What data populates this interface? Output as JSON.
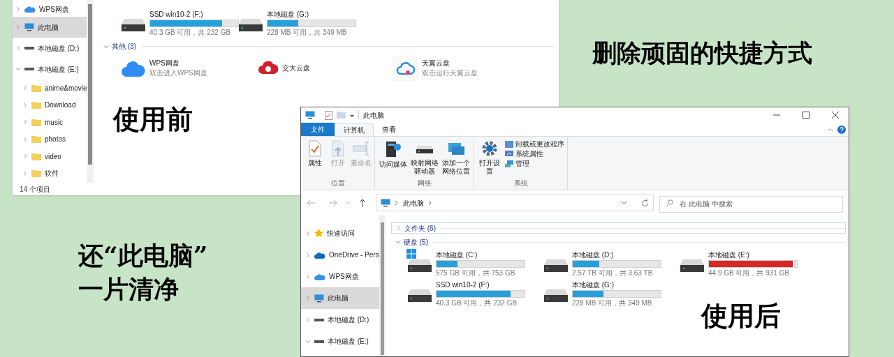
{
  "headline": "删除顽固的快捷方式",
  "summary": [
    "还“此电脑”",
    "一片清净"
  ],
  "before_label": "使用前",
  "after_label": "使用后",
  "before_window": {
    "sidebar": [
      {
        "label": "WPS网盘",
        "selected": false,
        "expanded": false
      },
      {
        "label": "此电脑",
        "selected": true,
        "expanded": false
      },
      {
        "label": "本地磁盘 (D:)",
        "selected": false,
        "expanded": false
      },
      {
        "label": "本地磁盘 (E:)",
        "selected": false,
        "expanded": true,
        "children": [
          {
            "label": "anime&movie",
            "selected": false,
            "expanded": false
          },
          {
            "label": "Download",
            "selected": false,
            "expanded": false
          },
          {
            "label": "music",
            "selected": false,
            "expanded": false
          },
          {
            "label": "photos",
            "selected": false,
            "expanded": false
          },
          {
            "label": "video",
            "selected": false,
            "expanded": false
          },
          {
            "label": "软件",
            "selected": false,
            "expanded": false
          }
        ]
      }
    ],
    "drives": [
      {
        "name": "SSD win10-2 (F:)",
        "kind": "disk",
        "level": 0.82,
        "space": "40.3 GB 可用，共 232 GB"
      },
      {
        "name": "本地磁盘 (G:)",
        "kind": "disk",
        "level": 0.35,
        "space": "228 MB 可用，共 349 MB"
      }
    ],
    "groups": [
      {
        "label": "其他 (3)",
        "expanded": true,
        "items": [
          {
            "name": "WPS网盘",
            "subtitle": "双击进入WPS网盘",
            "kind": "wps"
          },
          {
            "name": "交大云盘",
            "kind": "jd"
          },
          {
            "name": "天翼云盘",
            "subtitle": "双击运行天翼云盘",
            "kind": "ty"
          }
        ]
      }
    ],
    "status_bar": "14 个项目"
  },
  "after_window": {
    "title": "此电脑",
    "tabs": [
      {
        "label": "文件",
        "selected": false
      },
      {
        "label": "计算机",
        "selected": true
      },
      {
        "label": "查看",
        "selected": false
      }
    ],
    "ribbon": [
      {
        "label": "位置",
        "items": [
          {
            "label": "属性",
            "disabled": false
          },
          {
            "label": "打开",
            "disabled": true
          },
          {
            "label": "重命名",
            "disabled": true
          }
        ]
      },
      {
        "label": "网络",
        "items": [
          {
            "label": "访问媒体",
            "disabled": false
          },
          {
            "label": "映射网络驱动器",
            "disabled": false
          },
          {
            "label": "添加一个网络位置",
            "disabled": false
          }
        ]
      },
      {
        "label": "系统",
        "items": [
          {
            "label": "打开设置",
            "disabled": false
          }
        ],
        "small_items": [
          {
            "label": "卸载或更改程序"
          },
          {
            "label": "系统属性"
          },
          {
            "label": "管理"
          }
        ]
      }
    ],
    "breadcrumb": [
      "此电脑"
    ],
    "search": {
      "placeholder": "在 此电脑 中搜索"
    },
    "sidebar": [
      {
        "label": "快速访问",
        "selected": false,
        "expanded": false
      },
      {
        "label": "OneDrive - Pers",
        "selected": false,
        "expanded": false
      },
      {
        "label": "WPS网盘",
        "selected": false,
        "expanded": false
      },
      {
        "label": "此电脑",
        "selected": true,
        "expanded": false
      },
      {
        "label": "本地磁盘 (D:)",
        "selected": false,
        "expanded": false
      },
      {
        "label": "本地磁盘 (E:)",
        "selected": false,
        "expanded": true
      }
    ],
    "groups": [
      {
        "label": "文件夹 (6)",
        "expanded": false
      },
      {
        "label": "硬盘 (5)",
        "expanded": true
      }
    ],
    "drives": [
      {
        "name": "本地磁盘 (C:)",
        "kind": "system",
        "level": 0.24,
        "space": "575 GB 可用，共 753 GB"
      },
      {
        "name": "本地磁盘 (D:)",
        "kind": "disk",
        "level": 0.3,
        "space": "2.57 TB 可用，共 3.63 TB"
      },
      {
        "name": "本地磁盘 (E:)",
        "kind": "disk",
        "level": 0.95,
        "space": "44.9 GB 可用，共 931 GB"
      },
      {
        "name": "SSD win10-2 (F:)",
        "kind": "disk",
        "level": 0.84,
        "space": "40.3 GB 可用，共 232 GB"
      },
      {
        "name": "本地磁盘 (G:)",
        "kind": "disk",
        "level": 0.35,
        "space": "228 MB 可用，共 349 MB"
      }
    ]
  }
}
